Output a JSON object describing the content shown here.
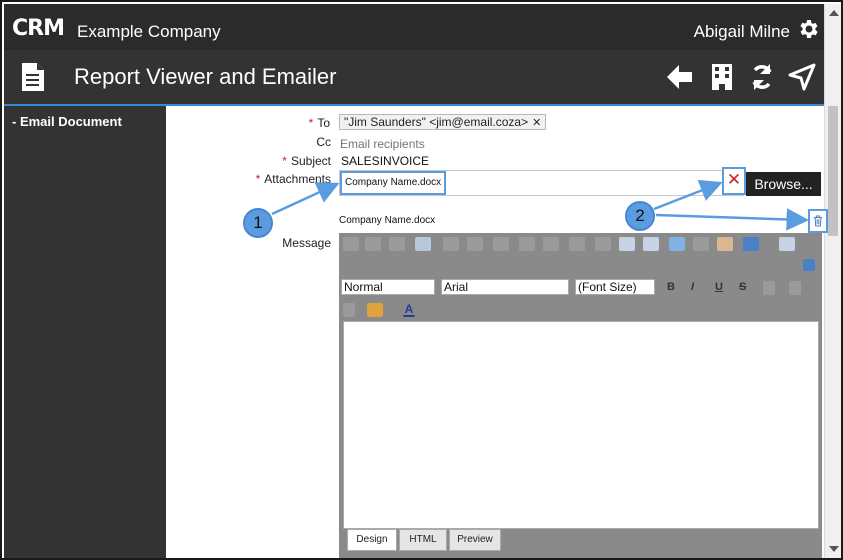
{
  "header": {
    "logo": "CRM",
    "company": "Example Company",
    "user": "Abigail Milne"
  },
  "titlebar": {
    "title": "Report Viewer and Emailer"
  },
  "sidebar": {
    "items": [
      {
        "label": "Email Document"
      }
    ]
  },
  "form": {
    "to_label": "To",
    "to_value": "\"Jim Saunders\" <jim@email.coza>",
    "cc_label": "Cc",
    "cc_placeholder": "Email recipients",
    "subject_label": "Subject",
    "subject_value": "SALESINVOICE",
    "attachments_label": "Attachments",
    "attachment_file": "Company Name.docx",
    "browse_label": "Browse...",
    "uploaded_file": "Company Name.docx",
    "message_label": "Message"
  },
  "editor": {
    "paragraph_format": "Normal",
    "font_name": "Arial",
    "font_size": "(Font Size)",
    "tabs": [
      "Design",
      "HTML",
      "Preview"
    ],
    "active_tab": "Design"
  },
  "callouts": [
    "1",
    "2"
  ],
  "colors": {
    "accent": "#3b87d6",
    "callout": "#5b9be0",
    "header_bg": "#2b2b2b",
    "required": "#d62020"
  }
}
